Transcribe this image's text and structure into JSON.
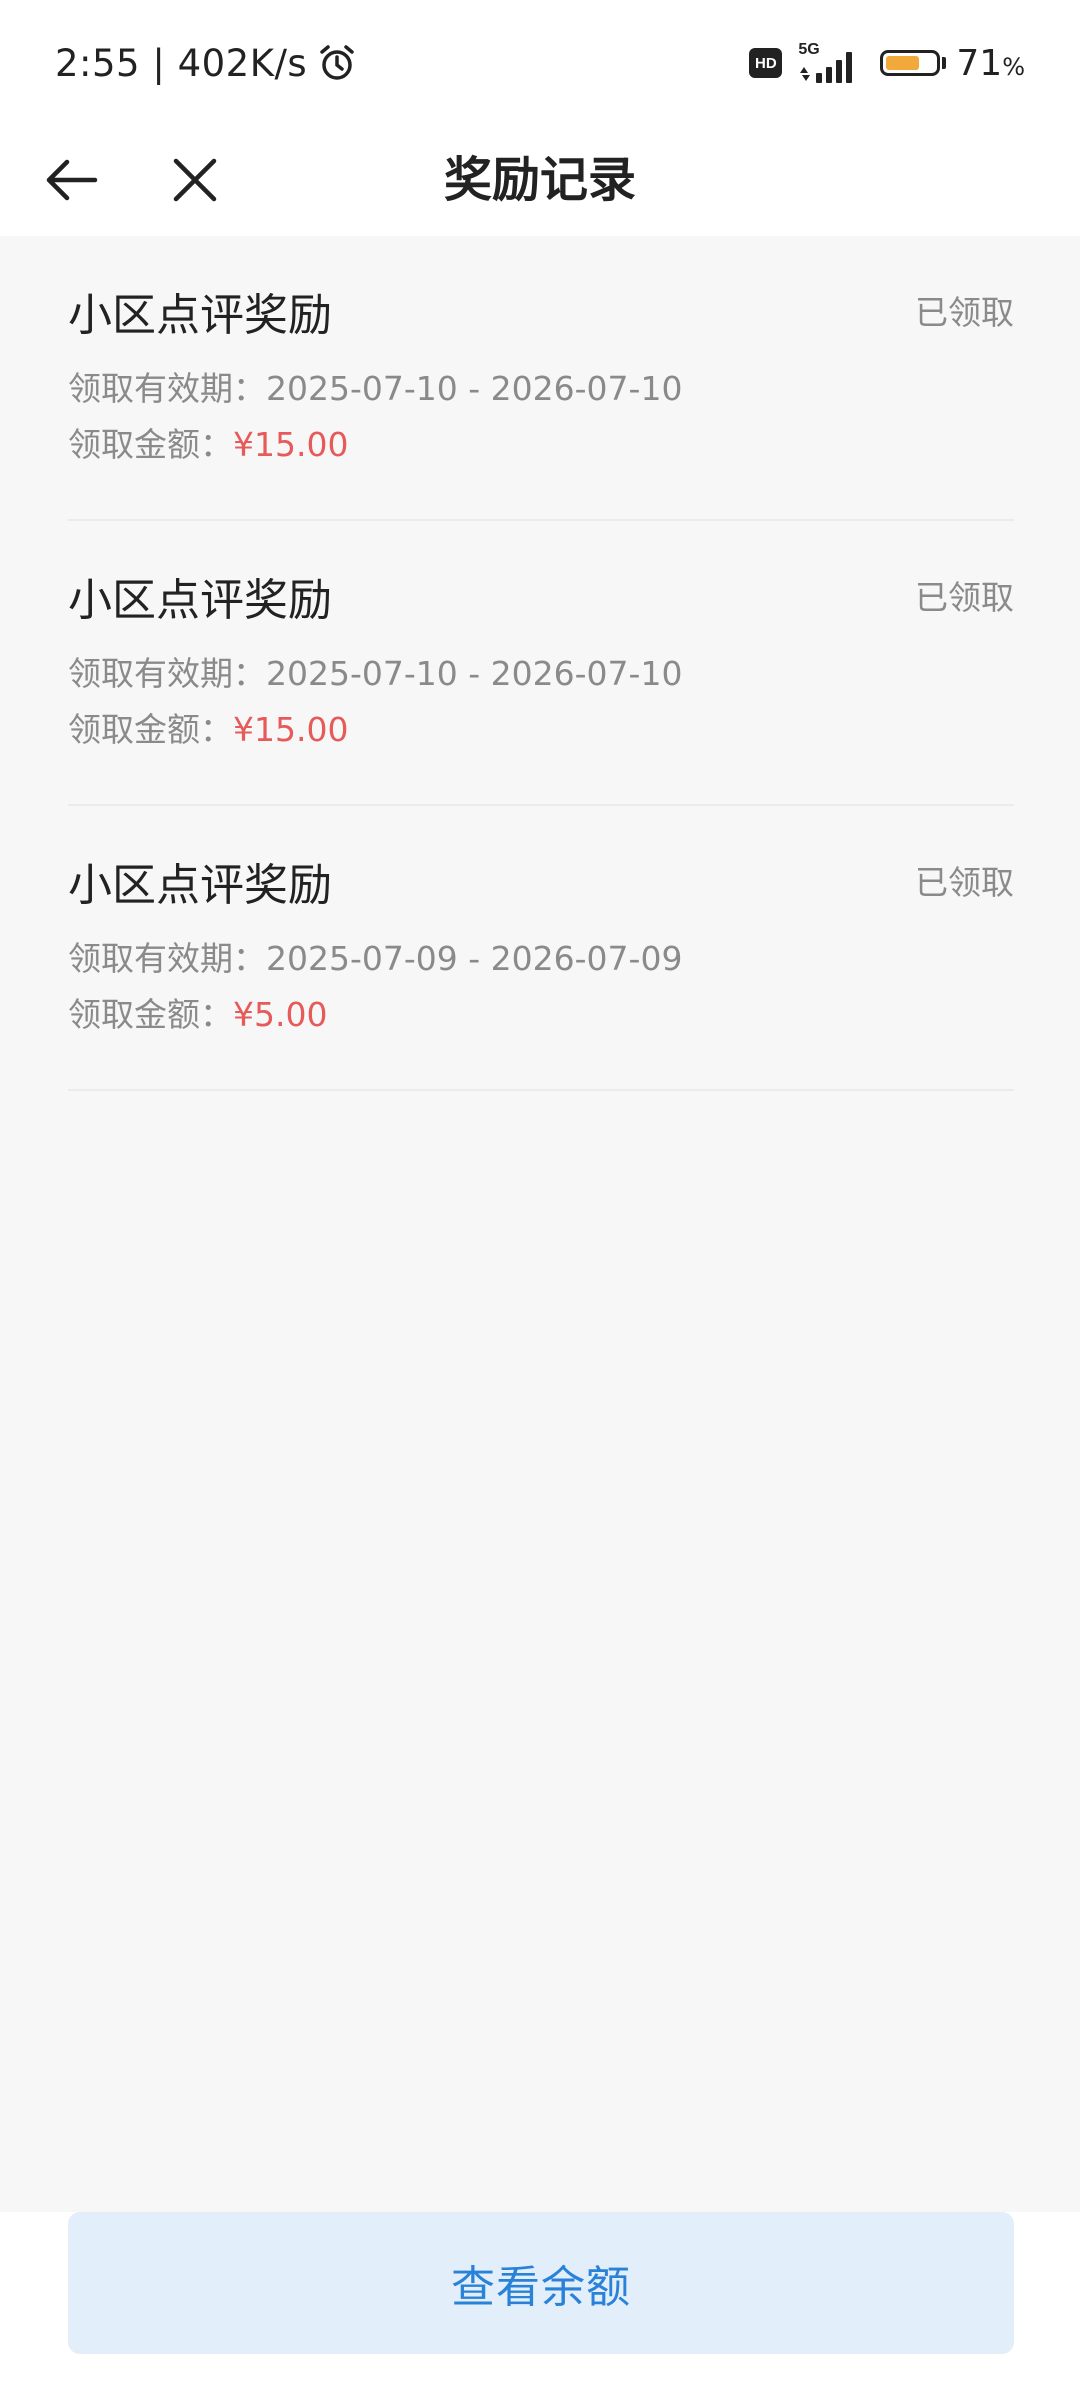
{
  "status_bar": {
    "time_speed": "2:55 | 402K/s",
    "alarm_icon": "alarm-clock-icon",
    "hd_label": "HD",
    "network_label": "5G",
    "battery_percent": "71",
    "battery_percent_sign": "%",
    "battery_level": 0.71,
    "battery_color": "#f2a93b"
  },
  "nav": {
    "back_icon": "arrow-left-icon",
    "close_icon": "close-icon",
    "title": "奖励记录"
  },
  "records": [
    {
      "title": "小区点评奖励",
      "status": "已领取",
      "validity_label": "领取有效期：",
      "validity_value": "2025-07-10 - 2026-07-10",
      "amount_label": "领取金额：",
      "amount_value": "¥15.00"
    },
    {
      "title": "小区点评奖励",
      "status": "已领取",
      "validity_label": "领取有效期：",
      "validity_value": "2025-07-10 - 2026-07-10",
      "amount_label": "领取金额：",
      "amount_value": "¥15.00"
    },
    {
      "title": "小区点评奖励",
      "status": "已领取",
      "validity_label": "领取有效期：",
      "validity_value": "2025-07-09 - 2026-07-09",
      "amount_label": "领取金额：",
      "amount_value": "¥5.00"
    }
  ],
  "bottom": {
    "balance_button_label": "查看余额"
  },
  "colors": {
    "accent_blue": "#2a82d8",
    "amount_red": "#e65a5a",
    "page_background": "#f7f7f7",
    "button_background": "#e2eefa"
  }
}
